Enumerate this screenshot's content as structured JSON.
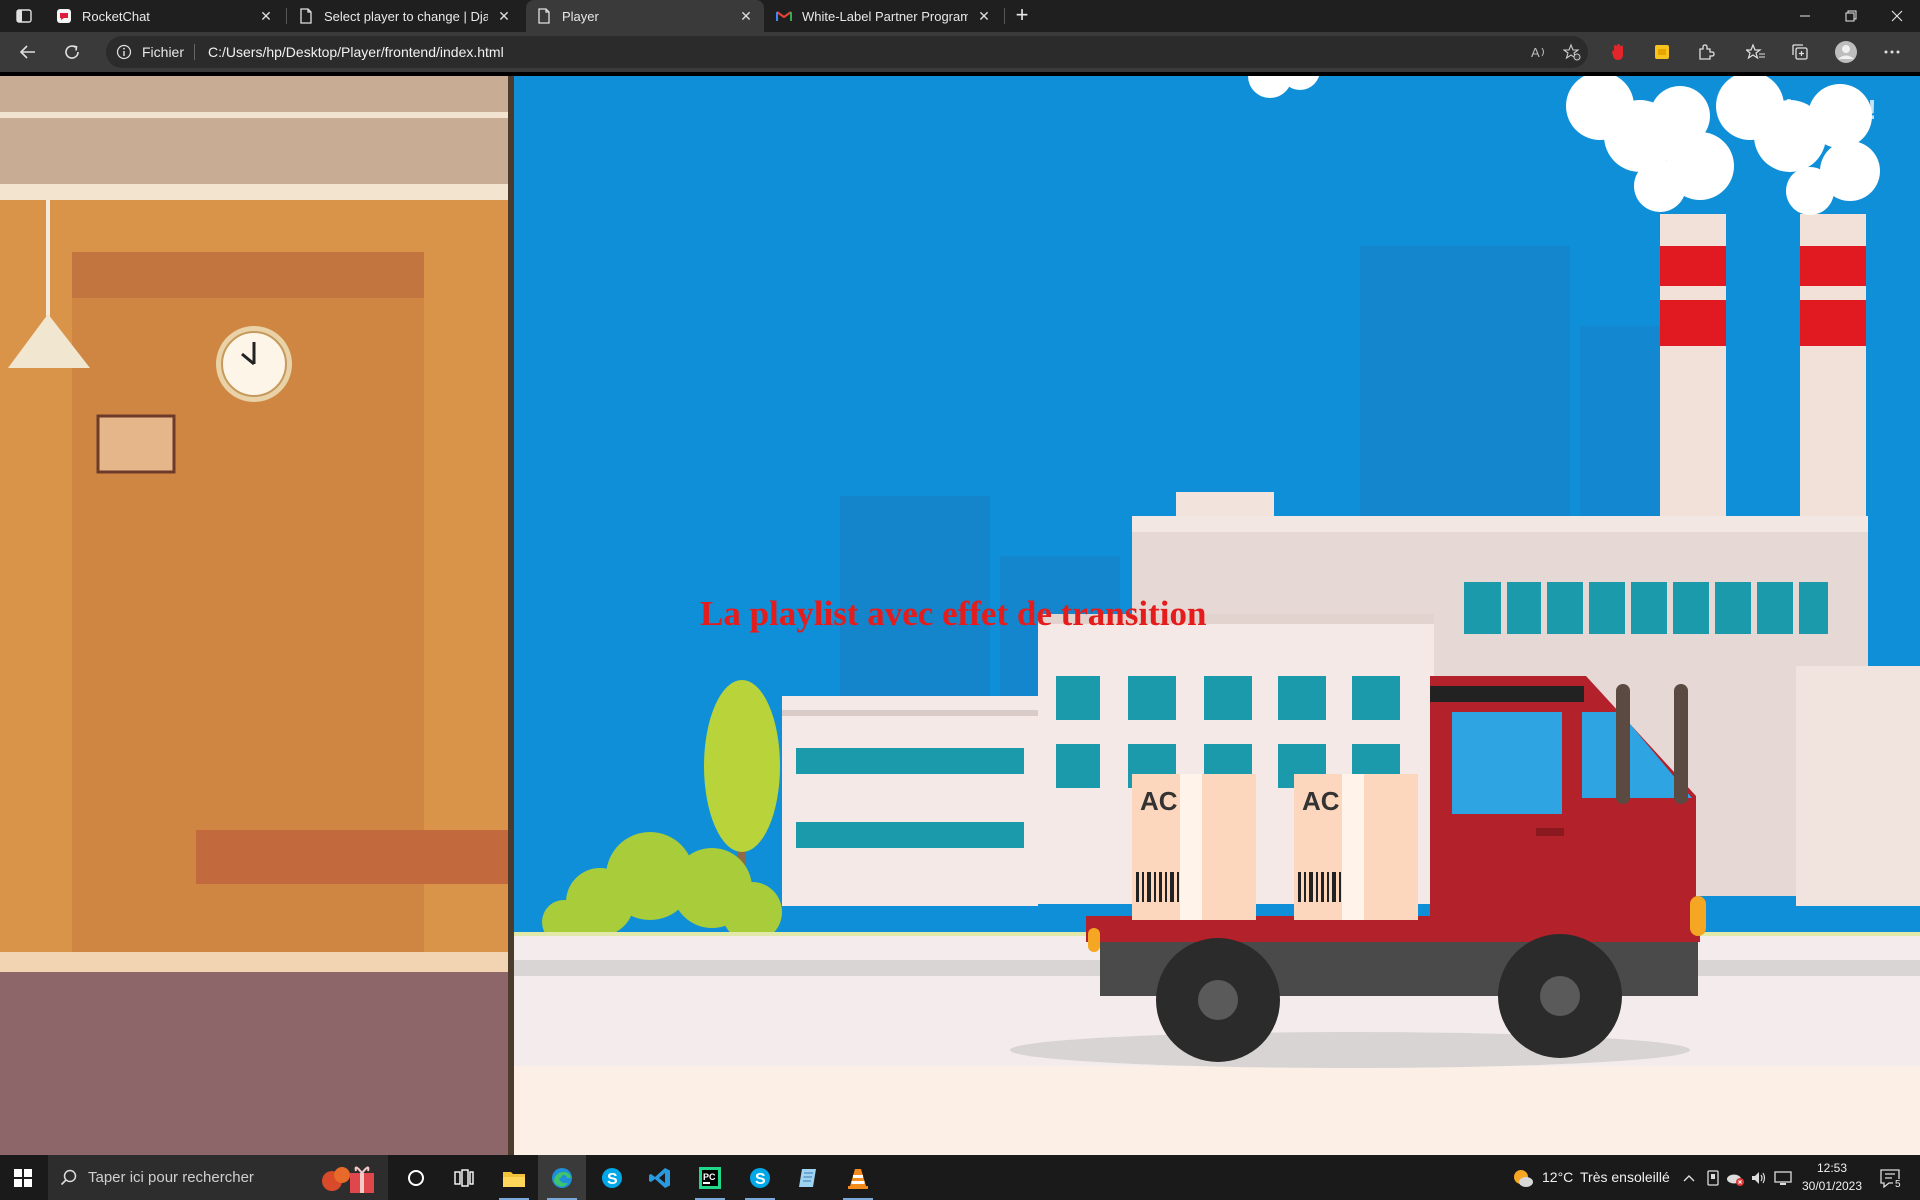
{
  "tabs": [
    {
      "title": "RocketChat",
      "favicon": "rocketchat-icon",
      "active": false
    },
    {
      "title": "Select player to change | Django",
      "favicon": "document-icon",
      "active": false
    },
    {
      "title": "Player",
      "favicon": "document-icon",
      "active": true
    },
    {
      "title": "White-Label Partner Program - fo",
      "favicon": "gmail-icon",
      "active": false
    }
  ],
  "tab_close_glyph": "✕",
  "new_tab_glyph": "+",
  "address_bar": {
    "scheme_label": "Fichier",
    "url": "C:/Users/hp/Desktop/Player/frontend/index.html"
  },
  "page": {
    "overlay_title": "La playlist avec effet de transition",
    "watermark": "edureka!",
    "video": {
      "box_label_1": "AC",
      "box_label_2": "AC"
    }
  },
  "taskbar": {
    "search_placeholder": "Taper ici pour rechercher",
    "apps": [
      "cortana-icon",
      "task-view-icon",
      "file-explorer-icon",
      "edge-icon",
      "skype-icon",
      "vscode-icon",
      "pycharm-icon",
      "skype-icon",
      "notepad-icon",
      "vlc-icon"
    ],
    "weather_temp": "12°C",
    "weather_text": "Très ensoleillé",
    "time": "12:53",
    "date": "30/01/2023",
    "notification_count": "5"
  },
  "colors": {
    "sky": "#0f8fd8",
    "wall": "#d9944a",
    "title_red": "#e51c1c",
    "truck_red": "#b3212a"
  }
}
